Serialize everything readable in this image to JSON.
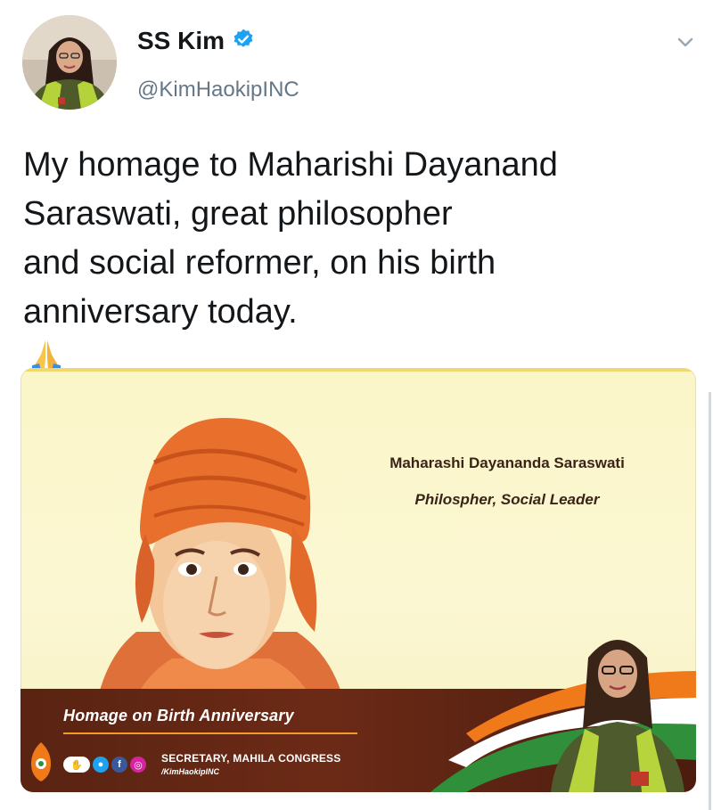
{
  "tweet": {
    "author_name": "SS Kim",
    "handle": "@KimHaokipINC",
    "text_lines": [
      "My homage to Maharishi Dayanand",
      "Saraswati, great philosopher",
      "and social reformer, on his birth",
      "anniversary today."
    ],
    "emoji": "folded-hands-emoji",
    "icons": {
      "verified": "verified-badge-icon",
      "more": "chevron-down-icon"
    },
    "colors": {
      "verified": "#1da1f2",
      "handle": "#657786",
      "text": "#14171a"
    }
  },
  "card": {
    "caption_title": "Maharashi Dayananda Saraswati",
    "caption_subtitle": "Philospher, Social Leader",
    "band_title": "Homage on Birth Anniversary",
    "secretary_title": "SECRETARY, MAHILA CONGRESS",
    "secretary_handle": "/KimHaokipINC",
    "social_icons": [
      "congress-logo-icon",
      "twitter-icon",
      "facebook-icon",
      "instagram-icon"
    ],
    "colors": {
      "background": "#fbf6c8",
      "band": "#5a2312",
      "accent": "#f39a2a",
      "saffron": "#f07a1a",
      "green": "#2f8f3a"
    }
  }
}
